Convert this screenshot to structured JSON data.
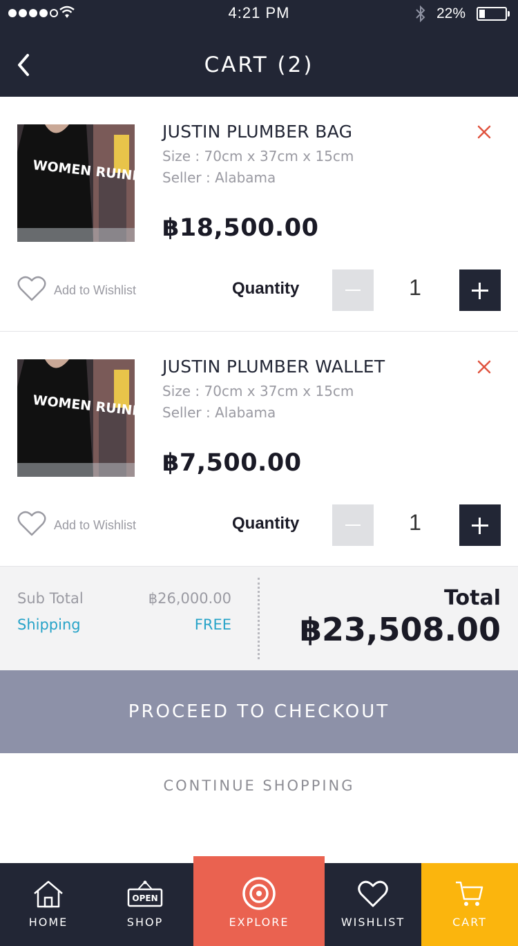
{
  "status_bar": {
    "time": "4:21 PM",
    "battery": "22%",
    "battery_level": 0.22
  },
  "header": {
    "title": "CART (2)",
    "back_icon": "chevron-left-icon"
  },
  "items": [
    {
      "name": "JUSTIN PLUMBER BAG",
      "size": "Size : 70cm x 37cm x 15cm",
      "seller": "Seller : Alabama",
      "price": "฿18,500.00",
      "image_text": "WOMEN RUINED MY LIFE",
      "wishlist_label": "Add to Wishlist",
      "quantity_label": "Quantity",
      "quantity": "1"
    },
    {
      "name": "JUSTIN PLUMBER WALLET",
      "size": "Size : 70cm x 37cm x 15cm",
      "seller": "Seller : Alabama",
      "price": "฿7,500.00",
      "image_text": "WOMEN RUINED MY LIFE",
      "wishlist_label": "Add to Wishlist",
      "quantity_label": "Quantity",
      "quantity": "1"
    }
  ],
  "summary": {
    "subtotal_label": "Sub Total",
    "subtotal_value": "฿26,000.00",
    "shipping_label": "Shipping",
    "shipping_value": "FREE",
    "total_label": "Total",
    "total_value": "฿23,508.00"
  },
  "actions": {
    "checkout": "PROCEED TO CHECKOUT",
    "continue": "CONTINUE SHOPPING"
  },
  "tabs": [
    {
      "label": "HOME",
      "icon": "home-icon"
    },
    {
      "label": "SHOP",
      "icon": "shop-sign-icon",
      "sign_text": "OPEN"
    },
    {
      "label": "EXPLORE",
      "icon": "target-icon"
    },
    {
      "label": "WISHLIST",
      "icon": "heart-icon"
    },
    {
      "label": "CART",
      "icon": "cart-icon"
    }
  ],
  "colors": {
    "header_bg": "#222635",
    "explore_tab": "#ea6250",
    "cart_tab": "#fbb50d",
    "checkout_bg": "#8d91a8",
    "shipping": "#27a3c8",
    "remove": "#e0533f"
  }
}
